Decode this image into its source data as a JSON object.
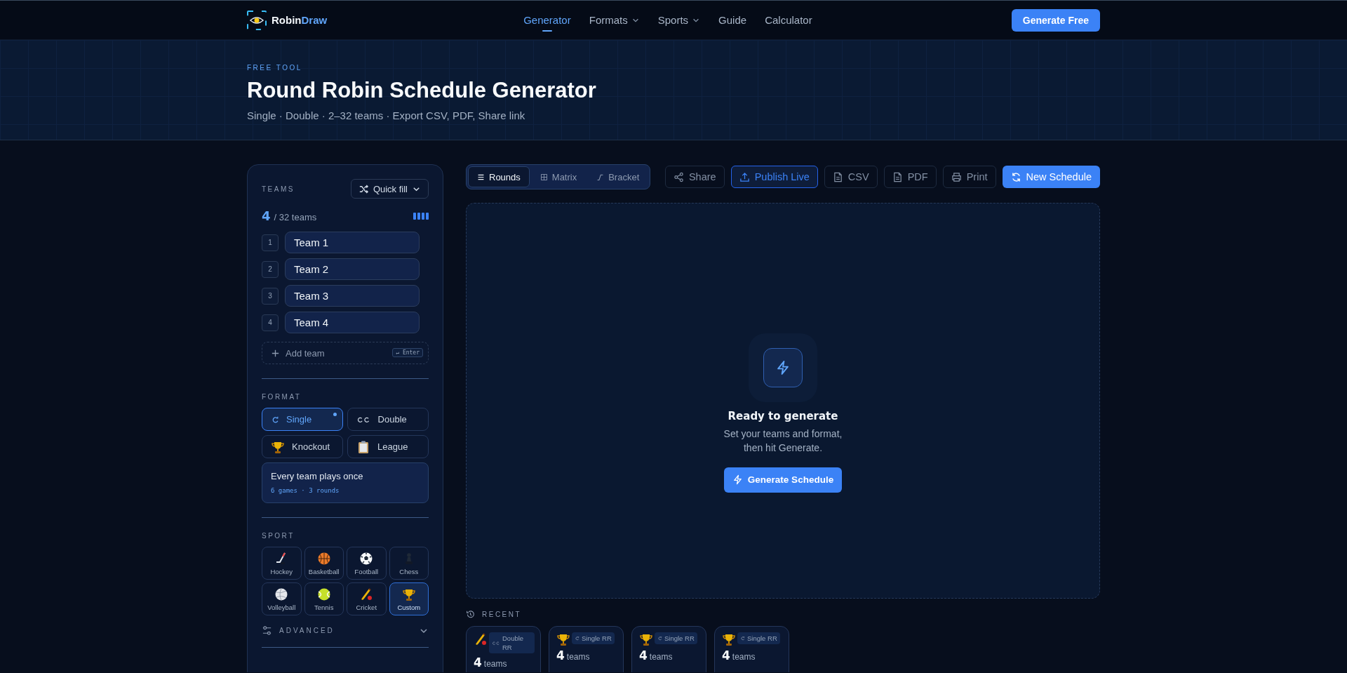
{
  "nav": {
    "brand": {
      "part_1": "Robin",
      "part_2": "Draw"
    },
    "links": [
      {
        "label": "Generator",
        "selected": true,
        "dropdown": false
      },
      {
        "label": "Formats",
        "selected": false,
        "dropdown": true
      },
      {
        "label": "Sports",
        "selected": false,
        "dropdown": true
      },
      {
        "label": "Guide",
        "selected": false,
        "dropdown": false
      },
      {
        "label": "Calculator",
        "selected": false,
        "dropdown": false
      }
    ],
    "cta": "Generate Free"
  },
  "hero": {
    "eyebrow": "FREE TOOL",
    "title": "Round Robin Schedule Generator",
    "subtitle": "Single · Double · 2–32 teams · Export CSV, PDF, Share link"
  },
  "panel": {
    "teams_label": "TEAMS",
    "quick_fill": "Quick fill",
    "count": "4",
    "count_suffix": "/ 32 teams",
    "teams": [
      {
        "number": "1",
        "value": "Team 1"
      },
      {
        "number": "2",
        "value": "Team 2"
      },
      {
        "number": "3",
        "value": "Team 3"
      },
      {
        "number": "4",
        "value": "Team 4"
      }
    ],
    "add_team": {
      "placeholder": "Add team",
      "key_symbol": "↵",
      "key": "Enter"
    },
    "format_label": "FORMAT",
    "formats": [
      {
        "label": "Single",
        "kind": "single",
        "selected": true
      },
      {
        "label": "Double",
        "kind": "double",
        "selected": false
      },
      {
        "label": "Knockout",
        "kind": "trophy",
        "selected": false
      },
      {
        "label": "League",
        "kind": "clipboard",
        "selected": false
      }
    ],
    "format_info": {
      "title": "Every team plays once",
      "detail": "6 games · 3 rounds"
    },
    "sport_label": "SPORT",
    "sports": [
      {
        "label": "Hockey",
        "kind": "hockey",
        "selected": false
      },
      {
        "label": "Basketball",
        "kind": "basketball",
        "selected": false
      },
      {
        "label": "Football",
        "kind": "football",
        "selected": false
      },
      {
        "label": "Chess",
        "kind": "chess",
        "selected": false
      },
      {
        "label": "Volleyball",
        "kind": "volleyball",
        "selected": false
      },
      {
        "label": "Tennis",
        "kind": "tennis",
        "selected": false
      },
      {
        "label": "Cricket",
        "kind": "cricket",
        "selected": false
      },
      {
        "label": "Custom",
        "kind": "trophy",
        "selected": true
      }
    ],
    "advanced": {
      "label": "ADVANCED",
      "expanded": false
    }
  },
  "toolbar": {
    "views": [
      {
        "label": "Rounds",
        "kind": "list",
        "selected": true
      },
      {
        "label": "Matrix",
        "kind": "grid",
        "selected": false
      },
      {
        "label": "Bracket",
        "kind": "bracket",
        "selected": false
      }
    ],
    "actions": [
      {
        "label": "Share",
        "kind": "share"
      },
      {
        "label": "Publish Live",
        "kind": "upload"
      },
      {
        "label": "CSV",
        "kind": "file"
      },
      {
        "label": "PDF",
        "kind": "file"
      },
      {
        "label": "Print",
        "kind": "printer"
      },
      {
        "label": "New Schedule",
        "kind": "refresh"
      }
    ]
  },
  "empty_state": {
    "title": "Ready to generate",
    "text": "Set your teams and format, then hit Generate.",
    "button": "Generate Schedule"
  },
  "recent": {
    "label": "RECENT",
    "items": [
      {
        "kind": "cricket",
        "tag": {
          "kind": "double",
          "label": "Double RR"
        },
        "count": "4",
        "unit": "teams"
      },
      {
        "kind": "trophy",
        "tag": {
          "kind": "single",
          "label": "Single RR"
        },
        "count": "4",
        "unit": "teams"
      },
      {
        "kind": "trophy",
        "tag": {
          "kind": "single",
          "label": "Single RR"
        },
        "count": "4",
        "unit": "teams"
      },
      {
        "kind": "trophy",
        "tag": {
          "kind": "single",
          "label": "Single RR"
        },
        "count": "4",
        "unit": "teams"
      }
    ]
  }
}
